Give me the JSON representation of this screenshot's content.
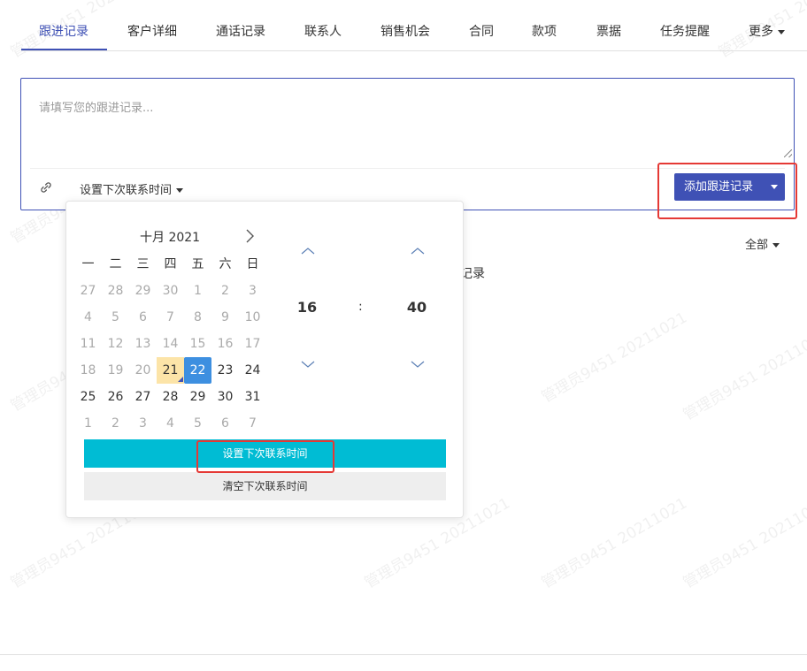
{
  "watermark": "管理员9451 20211021",
  "tabs": [
    {
      "label": "跟进记录",
      "active": true
    },
    {
      "label": "客户详细"
    },
    {
      "label": "通话记录"
    },
    {
      "label": "联系人"
    },
    {
      "label": "销售机会"
    },
    {
      "label": "合同"
    },
    {
      "label": "款项"
    },
    {
      "label": "票据"
    },
    {
      "label": "任务提醒"
    },
    {
      "label": "更多"
    }
  ],
  "editor": {
    "placeholder": "请填写您的跟进记录...",
    "value": "",
    "next_time_label": "设置下次联系时间",
    "attach_icon": "link-icon",
    "add_button_label": "添加跟进记录"
  },
  "filter": {
    "label": "全部"
  },
  "partial_text": "记录",
  "datepicker": {
    "header": "十月 2021",
    "weekdays": [
      "一",
      "二",
      "三",
      "四",
      "五",
      "六",
      "日"
    ],
    "weeks": [
      [
        {
          "d": "27",
          "m": 1
        },
        {
          "d": "28",
          "m": 1
        },
        {
          "d": "29",
          "m": 1
        },
        {
          "d": "30",
          "m": 1
        },
        {
          "d": "1",
          "m": 1
        },
        {
          "d": "2",
          "m": 1
        },
        {
          "d": "3",
          "m": 1
        }
      ],
      [
        {
          "d": "4",
          "m": 1
        },
        {
          "d": "5",
          "m": 1
        },
        {
          "d": "6",
          "m": 1
        },
        {
          "d": "7",
          "m": 1
        },
        {
          "d": "8",
          "m": 1
        },
        {
          "d": "9",
          "m": 1
        },
        {
          "d": "10",
          "m": 1
        }
      ],
      [
        {
          "d": "11",
          "m": 1
        },
        {
          "d": "12",
          "m": 1
        },
        {
          "d": "13",
          "m": 1
        },
        {
          "d": "14",
          "m": 1
        },
        {
          "d": "15",
          "m": 1
        },
        {
          "d": "16",
          "m": 1
        },
        {
          "d": "17",
          "m": 1
        }
      ],
      [
        {
          "d": "18",
          "m": 1
        },
        {
          "d": "19",
          "m": 1
        },
        {
          "d": "20",
          "m": 1
        },
        {
          "d": "21",
          "today": true
        },
        {
          "d": "22",
          "selected": true
        },
        {
          "d": "23"
        },
        {
          "d": "24"
        }
      ],
      [
        {
          "d": "25"
        },
        {
          "d": "26"
        },
        {
          "d": "27"
        },
        {
          "d": "28"
        },
        {
          "d": "29"
        },
        {
          "d": "30"
        },
        {
          "d": "31"
        }
      ],
      [
        {
          "d": "1",
          "m": 1
        },
        {
          "d": "2",
          "m": 1
        },
        {
          "d": "3",
          "m": 1
        },
        {
          "d": "4",
          "m": 1
        },
        {
          "d": "5",
          "m": 1
        },
        {
          "d": "6",
          "m": 1
        },
        {
          "d": "7",
          "m": 1
        }
      ]
    ],
    "hour": "16",
    "minute": "40",
    "separator": ":",
    "set_button_label": "设置下次联系时间",
    "clear_button_label": "清空下次联系时间"
  },
  "colors": {
    "primary": "#3f51b5",
    "set_button": "#00bcd4",
    "selected_day": "#3d8fe0",
    "today": "#fce4a8",
    "highlight": "#e53935"
  }
}
